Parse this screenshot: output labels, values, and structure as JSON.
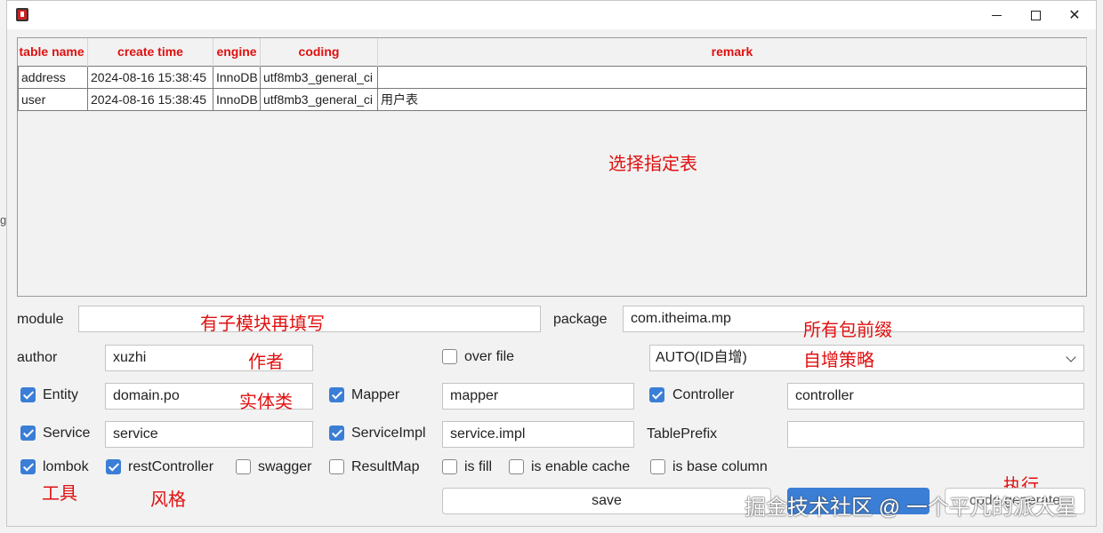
{
  "titlebar": {
    "icon": "app-icon"
  },
  "table": {
    "columns": [
      "table name",
      "create time",
      "engine",
      "coding",
      "remark"
    ],
    "rows": [
      [
        "address",
        "2024-08-16 15:38:45",
        "InnoDB",
        "utf8mb3_general_ci",
        ""
      ],
      [
        "user",
        "2024-08-16 15:38:45",
        "InnoDB",
        "utf8mb3_general_ci",
        "用户表"
      ]
    ]
  },
  "annotations": {
    "select_table": "选择指定表",
    "module_hint": "有子模块再填写",
    "package_hint": "所有包前缀",
    "author_hint": "作者",
    "strategy_hint": "自增策略",
    "entity_hint": "实体类",
    "tool_hint": "工具",
    "style_hint": "风格",
    "execute_hint": "执行"
  },
  "form": {
    "module_label": "module",
    "module_value": "",
    "package_label": "package",
    "package_value": "com.itheima.mp",
    "author_label": "author",
    "author_value": "xuzhi",
    "over_file_label": "over file",
    "over_file_checked": false,
    "id_type_value": "AUTO(ID自增)",
    "entity_label": "Entity",
    "entity_value": "domain.po",
    "mapper_label": "Mapper",
    "mapper_value": "mapper",
    "controller_label": "Controller",
    "controller_value": "controller",
    "service_label": "Service",
    "service_value": "service",
    "serviceimpl_label": "ServiceImpl",
    "serviceimpl_value": "service.impl",
    "tableprefix_label": "TablePrefix",
    "tableprefix_value": "",
    "lombok_label": "lombok",
    "restcontroller_label": "restController",
    "swagger_label": "swagger",
    "resultmap_label": "ResultMap",
    "isfill_label": "is fill",
    "iscache_label": "is enable cache",
    "isbase_label": "is base column"
  },
  "buttons": {
    "save": "save",
    "code_generate": "code generate"
  },
  "watermark": "掘金技术社区 @ 一个平凡的派大星",
  "colors": {
    "accent": "#3b7ed6",
    "annotation": "#e01010"
  }
}
